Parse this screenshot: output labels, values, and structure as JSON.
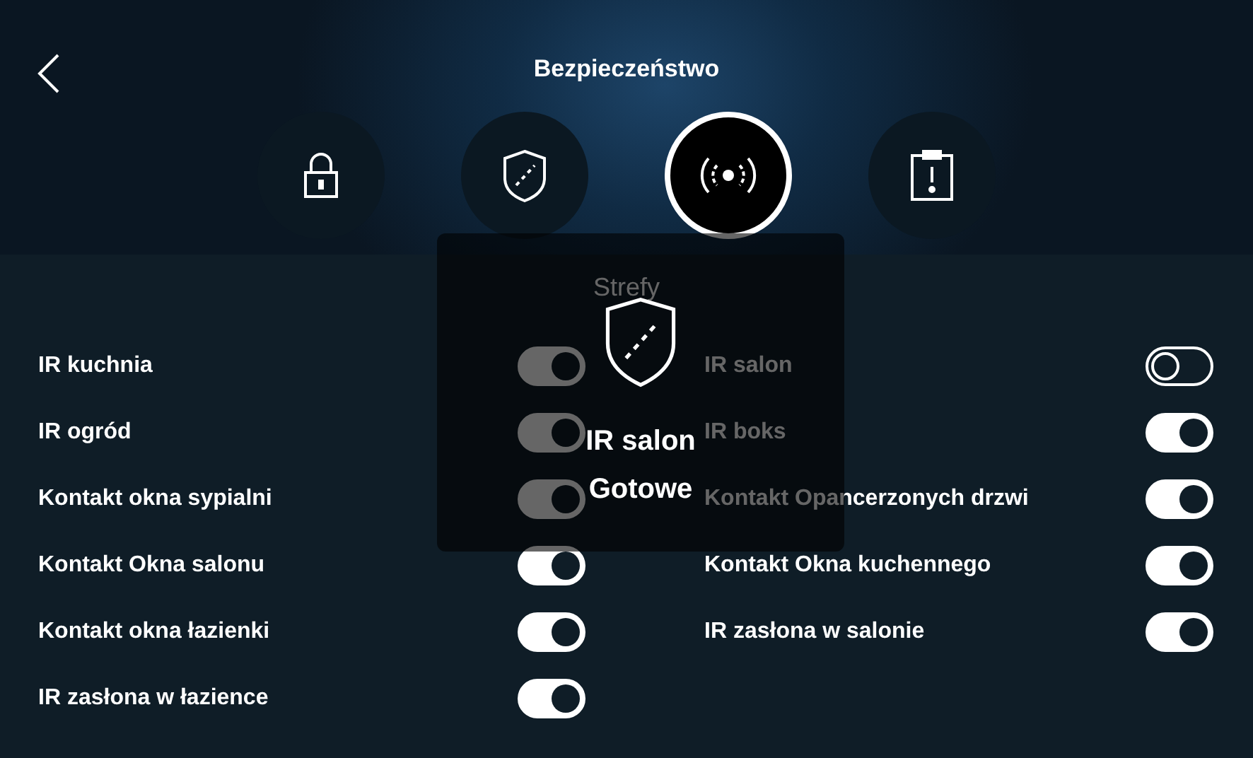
{
  "header": {
    "title": "Bezpieczeństwo"
  },
  "tabs": [
    {
      "kind": "lock",
      "selected": false
    },
    {
      "kind": "shield",
      "selected": false
    },
    {
      "kind": "sensor",
      "selected": true
    },
    {
      "kind": "alert",
      "selected": false
    }
  ],
  "zones": {
    "title": "Strefy",
    "left": [
      {
        "label": "IR kuchnia",
        "on": true
      },
      {
        "label": "IR ogród",
        "on": true
      },
      {
        "label": "Kontakt okna sypialni",
        "on": true
      },
      {
        "label": "Kontakt Okna salonu",
        "on": true
      },
      {
        "label": "Kontakt okna łazienki",
        "on": true
      },
      {
        "label": "IR zasłona w łazience",
        "on": true
      }
    ],
    "right": [
      {
        "label": "IR salon",
        "on": false
      },
      {
        "label": "IR boks",
        "on": true
      },
      {
        "label": "Kontakt Opancerzonych drzwi",
        "on": true
      },
      {
        "label": "Kontakt Okna kuchennego",
        "on": true
      },
      {
        "label": "IR zasłona w salonie",
        "on": true
      }
    ]
  },
  "popup": {
    "title": "IR salon",
    "status": "Gotowe"
  }
}
